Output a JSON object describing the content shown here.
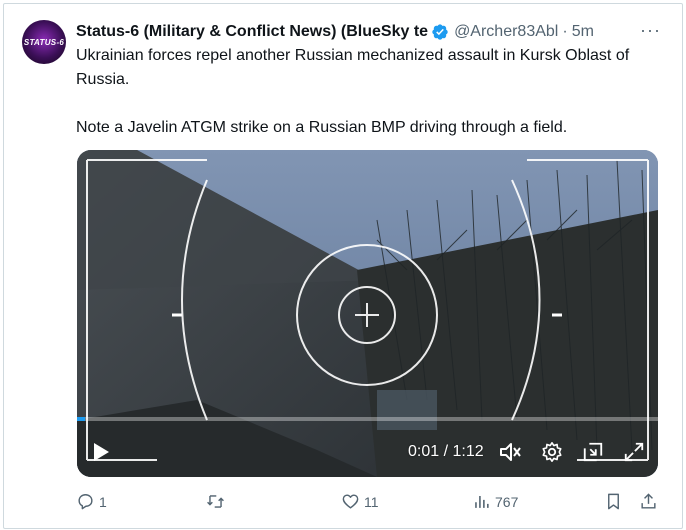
{
  "post": {
    "avatar_text": "STATUS-6",
    "author_name": "Status-6 (Military & Conflict News) (BlueSky tе",
    "handle": "@Archer83Abl",
    "separator": "·",
    "time": "5m",
    "more_label": "···",
    "text_lines": [
      "Ukrainian forces repel another Russian mechanized assault in Kursk Oblast of Russia.",
      "Note a Javelin ATGM strike on a Russian BMP driving through a field."
    ]
  },
  "video": {
    "current_time": "0:01",
    "duration": "1:12",
    "timecode": "0:01 / 1:12",
    "controls": [
      "play-icon",
      "mute-icon",
      "settings-icon",
      "pip-icon",
      "fullscreen-icon"
    ],
    "progress_fraction": 0.014
  },
  "actions": {
    "replies": "1",
    "reposts": "",
    "likes": "11",
    "views": "767",
    "bookmark_icon": "bookmark-icon",
    "share_icon": "share-icon"
  },
  "colors": {
    "verified": "#1d9bf0",
    "secondary_text": "#536471",
    "border": "#cfd9de"
  }
}
